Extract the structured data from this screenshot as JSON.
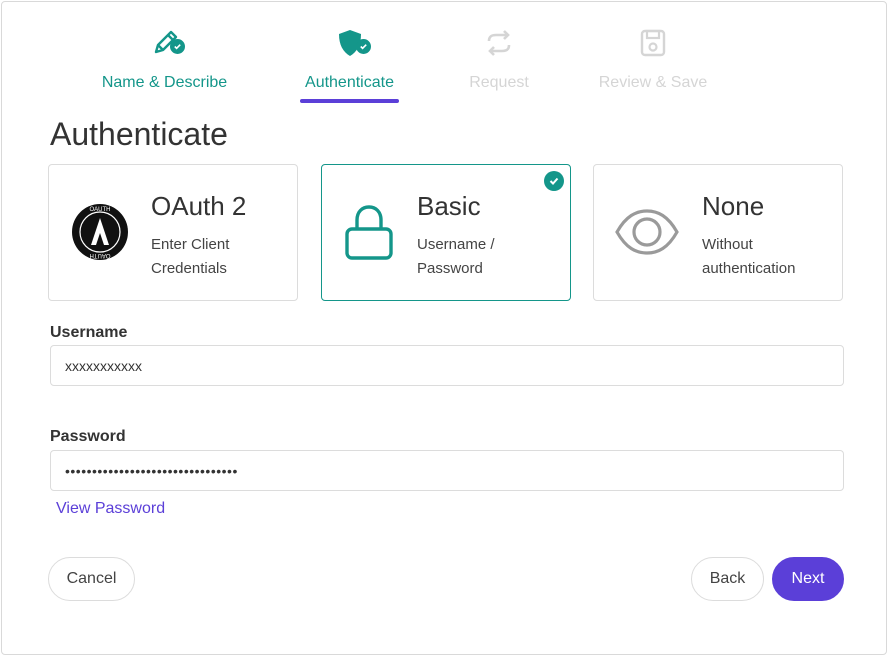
{
  "stepper": {
    "steps": [
      {
        "label": "Name & Describe",
        "state": "done",
        "icon": "pencil-icon"
      },
      {
        "label": "Authenticate",
        "state": "active",
        "icon": "shield-icon"
      },
      {
        "label": "Request",
        "state": "pending",
        "icon": "arrows-exchange-icon"
      },
      {
        "label": "Review & Save",
        "state": "pending",
        "icon": "save-icon"
      }
    ]
  },
  "page": {
    "title": "Authenticate"
  },
  "auth_options": [
    {
      "title": "OAuth 2",
      "description": "Enter Client Credentials",
      "icon": "oauth-logo-icon",
      "selected": false
    },
    {
      "title": "Basic",
      "description": "Username / Password",
      "icon": "lock-icon",
      "selected": true
    },
    {
      "title": "None",
      "description": "Without authentication",
      "icon": "eye-icon",
      "selected": false
    }
  ],
  "form": {
    "username_label": "Username",
    "username_value": "xxxxxxxxxxx",
    "password_label": "Password",
    "password_value": "••••••••••••••••••••••••••••••••",
    "view_password_label": "View Password"
  },
  "actions": {
    "cancel": "Cancel",
    "back": "Back",
    "next": "Next"
  },
  "colors": {
    "accent": "#14968a",
    "primary": "#5b3fd8",
    "pending": "#d5d5d5"
  },
  "logo_text": {
    "oauth_ring": "OAUTH"
  }
}
